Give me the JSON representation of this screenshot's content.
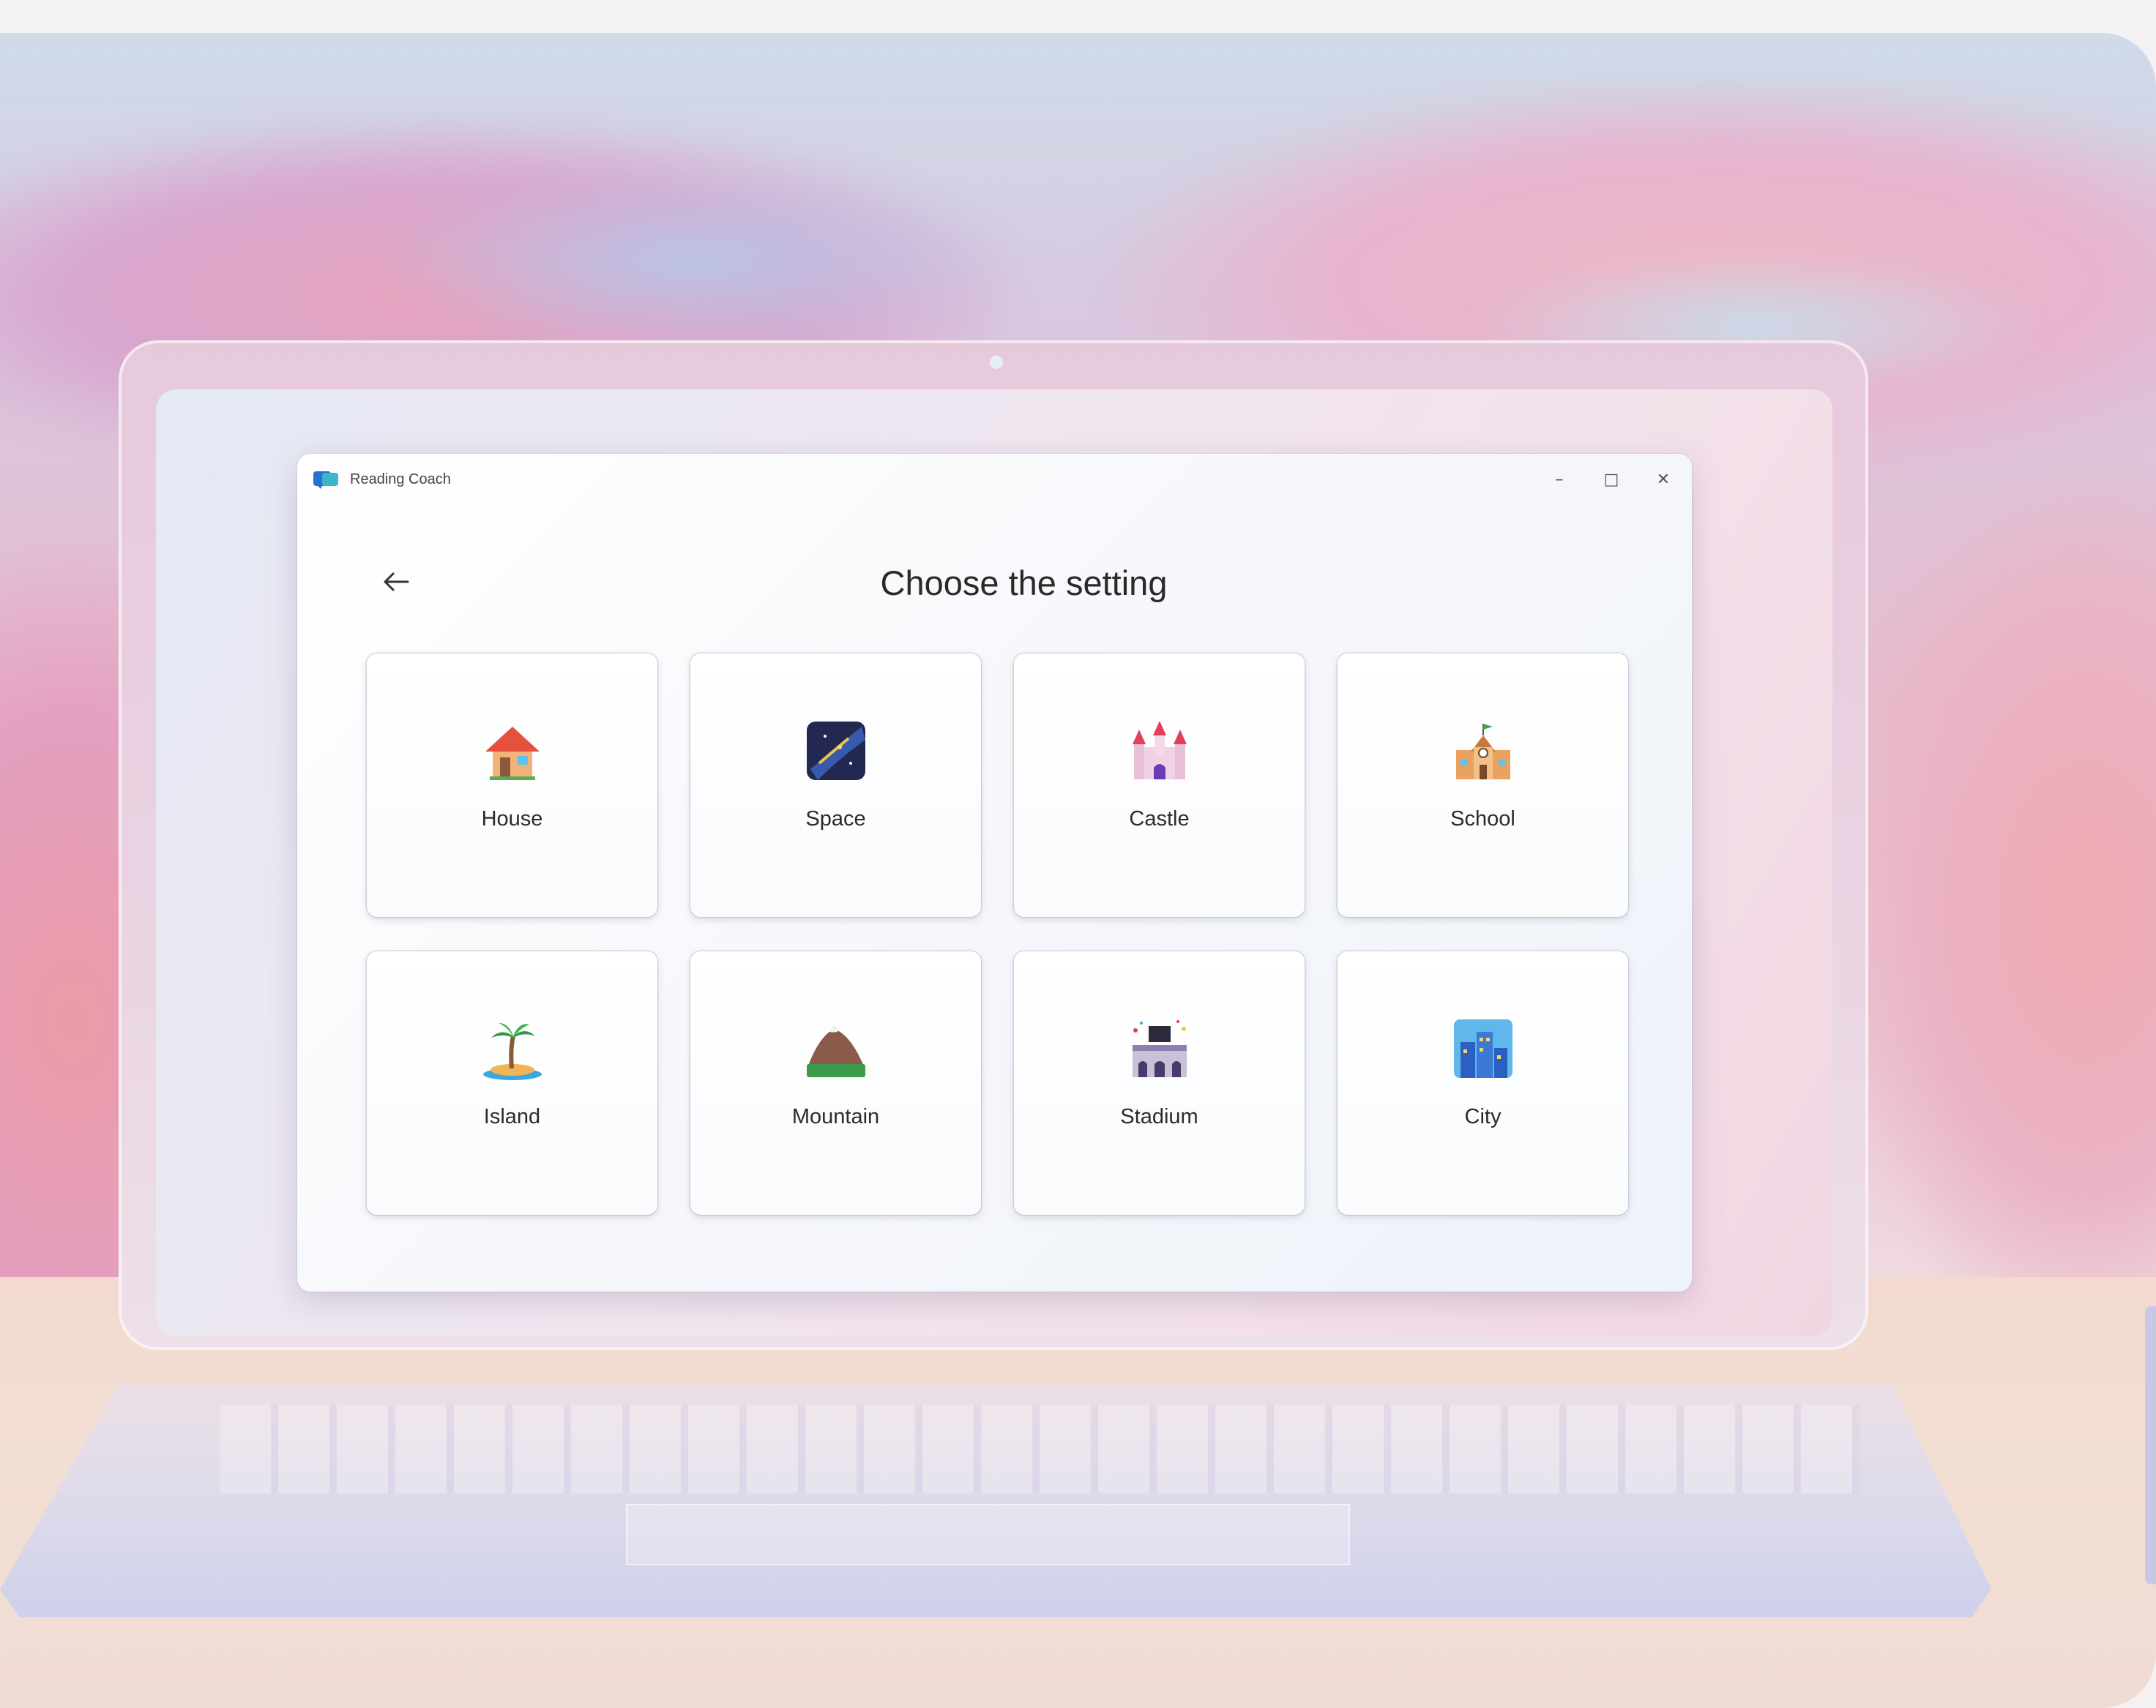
{
  "window": {
    "app_title": "Reading Coach",
    "minimize_glyph": "–",
    "maximize_glyph": "□",
    "close_glyph": "✕"
  },
  "page": {
    "title": "Choose the setting"
  },
  "settings": [
    {
      "label": "House",
      "icon": "house-icon"
    },
    {
      "label": "Space",
      "icon": "space-icon"
    },
    {
      "label": "Castle",
      "icon": "castle-icon"
    },
    {
      "label": "School",
      "icon": "school-icon"
    },
    {
      "label": "Island",
      "icon": "island-icon"
    },
    {
      "label": "Mountain",
      "icon": "mountain-icon"
    },
    {
      "label": "Stadium",
      "icon": "stadium-icon"
    },
    {
      "label": "City",
      "icon": "city-icon"
    }
  ],
  "colors": {
    "window_bg": "#ffffff",
    "heading_text": "#2a2a2a",
    "card_border": "#d7d7e1"
  }
}
